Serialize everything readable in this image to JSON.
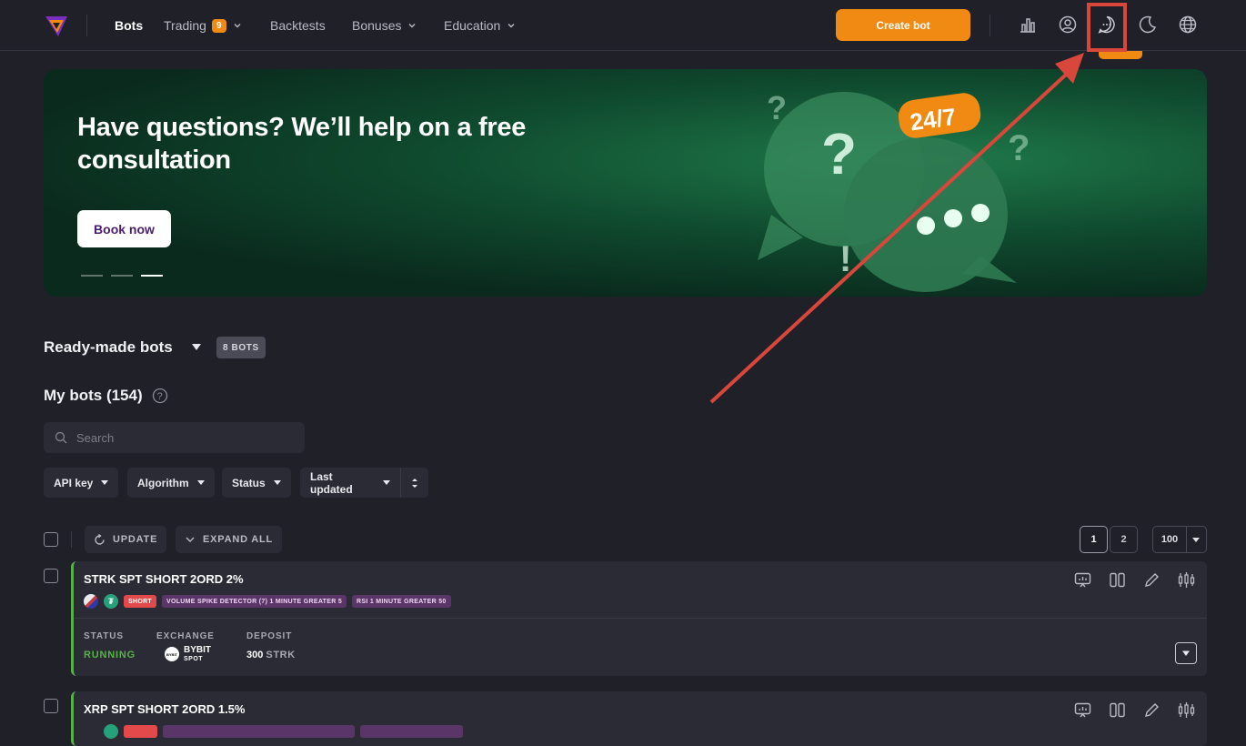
{
  "nav": {
    "items": [
      {
        "label": "Bots",
        "active": true
      },
      {
        "label": "Trading",
        "badge": "9",
        "dropdown": true
      },
      {
        "label": "Backtests"
      },
      {
        "label": "Bonuses",
        "dropdown": true
      },
      {
        "label": "Education",
        "dropdown": true
      }
    ],
    "create_label": "Create bot",
    "icons": [
      "chart-icon",
      "user-icon",
      "chat-icon",
      "moon-icon",
      "globe-icon"
    ]
  },
  "banner": {
    "title": "Have questions? We’ll help on a free consultation",
    "button": "Book now",
    "badge": "24/7",
    "slides": 3,
    "active_slide": 3
  },
  "ready_made": {
    "title": "Ready-made bots",
    "count": "8 BOTS"
  },
  "my_bots": {
    "title": "My bots (154)"
  },
  "search": {
    "placeholder": "Search"
  },
  "filters": [
    "API key",
    "Algorithm",
    "Status",
    "Last updated"
  ],
  "toolbar": {
    "update": "UPDATE",
    "expand": "EXPAND ALL"
  },
  "pagination": {
    "pages": [
      "1",
      "2"
    ],
    "current": "1",
    "per_page": "100"
  },
  "bots": [
    {
      "name": "STRK SPT SHORT 2ORD 2%",
      "side": "SHORT",
      "indicators": [
        "VOLUME SPIKE DETECTOR (7) 1 MINUTE GREATER 5",
        "RSI 1 MINUTE GREATER 50"
      ],
      "status_label": "STATUS",
      "status": "RUNNING",
      "exchange_label": "EXCHANGE",
      "exchange": "BYBIT",
      "exchange_sub": "SPOT",
      "exchange_logo": "BYBIT",
      "deposit_label": "DEPOSIT",
      "deposit_amount": "300",
      "deposit_coin": "STRK"
    },
    {
      "name": "XRP SPT SHORT 2ORD 1.5%"
    }
  ],
  "colors": {
    "accent": "#f08a12",
    "running": "#58b14a",
    "annotation": "#d9473c"
  }
}
